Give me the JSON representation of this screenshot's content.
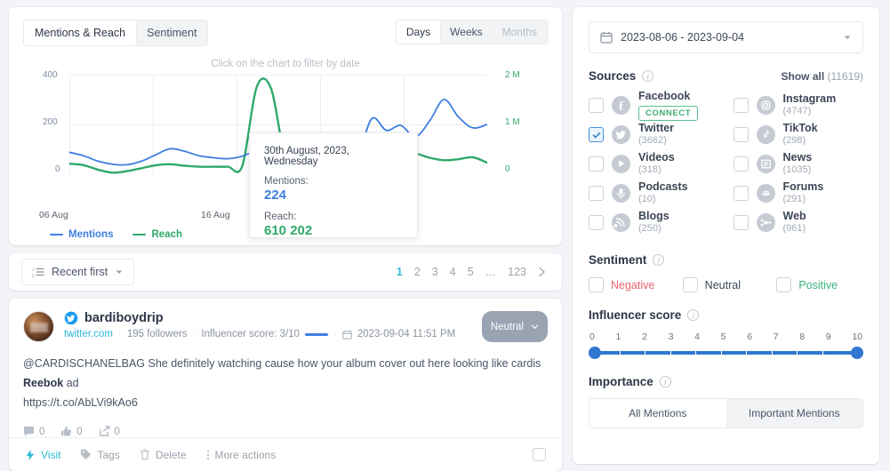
{
  "chart_panel": {
    "tabs": [
      {
        "label": "Mentions & Reach",
        "active": true
      },
      {
        "label": "Sentiment",
        "active": false
      }
    ],
    "granularity": [
      {
        "label": "Days",
        "state": "selected"
      },
      {
        "label": "Weeks",
        "state": "normal"
      },
      {
        "label": "Months",
        "state": "disabled"
      }
    ],
    "hint": "Click on the chart to filter by date",
    "tooltip": {
      "date": "30th August, 2023, Wednesday",
      "mentions_label": "Mentions:",
      "mentions_value": "224",
      "reach_label": "Reach:",
      "reach_value": "610 202"
    }
  },
  "chart_data": {
    "type": "line",
    "title": "",
    "xlabel": "",
    "ylabel": "",
    "x_tick_labels": [
      "06 Aug",
      "16 Aug"
    ],
    "left_axis": {
      "name": "Mentions",
      "ticks": [
        "0",
        "200",
        "400"
      ],
      "ylim": [
        0,
        400
      ],
      "color": "#3f7fe0"
    },
    "right_axis": {
      "name": "Reach",
      "ticks": [
        "0",
        "1 M",
        "2 M"
      ],
      "ylim": [
        0,
        2000000
      ],
      "color": "#2fa96a"
    },
    "grid": true,
    "legend": [
      {
        "name": "Mentions",
        "color": "#3f7fe0"
      },
      {
        "name": "Reach",
        "color": "#2fa96a"
      }
    ],
    "series": [
      {
        "name": "Mentions",
        "color": "#3f7fe0",
        "values": [
          88,
          74,
          52,
          40,
          38,
          52,
          78,
          102,
          92,
          74,
          66,
          62,
          72,
          94,
          90,
          84,
          84,
          86,
          88,
          80,
          74,
          224,
          176,
          196,
          150,
          214,
          300,
          230,
          186,
          200
        ]
      },
      {
        "name": "Reach",
        "color": "#2fa96a",
        "values": [
          210000,
          180000,
          90000,
          30000,
          60000,
          120000,
          180000,
          200000,
          170000,
          150000,
          150000,
          150000,
          165000,
          1750000,
          1720000,
          330000,
          340000,
          390000,
          410000,
          470000,
          610202,
          330000,
          400000,
          450000,
          420000,
          330000,
          280000,
          300000,
          340000,
          230000
        ]
      }
    ]
  },
  "list_toolbar": {
    "sort_label": "Recent first",
    "sort_icon": "sort-list-icon",
    "pages": [
      "1",
      "2",
      "3",
      "4",
      "5",
      "…",
      "123"
    ],
    "active_page": "1",
    "next_icon": "chevron-right-icon"
  },
  "post": {
    "username": "bardiboydrip",
    "network_icon": "twitter-icon",
    "source": "twitter.com",
    "followers": "195 followers",
    "influencer_score": "Influencer score: 3/10",
    "date_icon": "calendar-icon",
    "date": "2023-09-04 11:51 PM",
    "sentiment_badge": "Neutral",
    "text_prefix": "@CARDISCHANELBAG She definitely watching cause how your album cover out here looking like cardis ",
    "text_bold": "Reebok",
    "text_suffix": " ad",
    "link": "https://t.co/AbLVi9kAo6",
    "stats": [
      {
        "icon": "comment-icon",
        "value": "0"
      },
      {
        "icon": "thumbs-up-icon",
        "value": "0"
      },
      {
        "icon": "share-icon",
        "value": "0"
      }
    ],
    "actions": [
      {
        "label": "Visit",
        "icon": "lightning-icon",
        "primary": true
      },
      {
        "label": "Tags",
        "icon": "tag-icon",
        "primary": false
      },
      {
        "label": "Delete",
        "icon": "trash-icon",
        "primary": false
      },
      {
        "label": "More actions",
        "icon": "dots-vertical-icon",
        "primary": false
      }
    ]
  },
  "filters": {
    "date_range": "2023-08-06 - 2023-09-04",
    "date_icon": "calendar-icon",
    "sources": {
      "title": "Sources",
      "show_all_label": "Show all",
      "show_all_count": "(11619)",
      "items_left": [
        {
          "name": "Facebook",
          "count": "",
          "icon": "facebook-icon",
          "checked": false,
          "connect": "CONNECT"
        },
        {
          "name": "Twitter",
          "count": "(3662)",
          "icon": "twitter-icon",
          "checked": true
        },
        {
          "name": "Videos",
          "count": "(318)",
          "icon": "play-icon",
          "checked": false
        },
        {
          "name": "Podcasts",
          "count": "(10)",
          "icon": "microphone-icon",
          "checked": false
        },
        {
          "name": "Blogs",
          "count": "(250)",
          "icon": "rss-icon",
          "checked": false
        }
      ],
      "items_right": [
        {
          "name": "Instagram",
          "count": "(4747)",
          "icon": "instagram-icon",
          "checked": false
        },
        {
          "name": "TikTok",
          "count": "(298)",
          "icon": "tiktok-icon",
          "checked": false
        },
        {
          "name": "News",
          "count": "(1035)",
          "icon": "news-icon",
          "checked": false
        },
        {
          "name": "Forums",
          "count": "(291)",
          "icon": "forums-icon",
          "checked": false
        },
        {
          "name": "Web",
          "count": "(961)",
          "icon": "web-icon",
          "checked": false
        }
      ]
    },
    "sentiment": {
      "title": "Sentiment",
      "options": [
        {
          "label": "Negative",
          "color": "#e8636f",
          "checked": false
        },
        {
          "label": "Neutral",
          "color": "#3d4756",
          "checked": false
        },
        {
          "label": "Positive",
          "color": "#35b37e",
          "checked": false
        }
      ]
    },
    "influencer": {
      "title": "Influencer score",
      "ticks": [
        "0",
        "1",
        "2",
        "3",
        "4",
        "5",
        "6",
        "7",
        "8",
        "9",
        "10"
      ],
      "min": "0",
      "max": "10"
    },
    "importance": {
      "title": "Importance",
      "options": [
        {
          "label": "All Mentions",
          "active": true
        },
        {
          "label": "Important Mentions",
          "active": false
        }
      ]
    }
  }
}
